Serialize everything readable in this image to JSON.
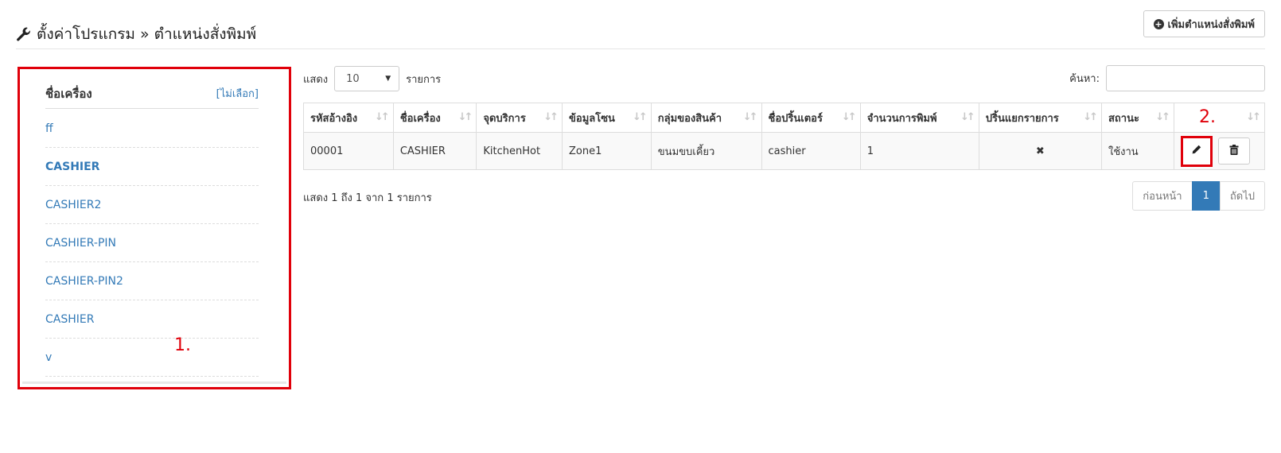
{
  "header": {
    "title": "ตั้งค่าโปรแกรม » ตำแหน่งสั่งพิมพ์",
    "add_button_label": "เพิ่มตำแหน่งสั่งพิมพ์"
  },
  "left_panel": {
    "heading": "ชื่อเครื่อง",
    "none_link": "[ไม่เลือก]",
    "devices": [
      "ff",
      "CASHIER",
      "CASHIER2",
      "CASHIER-PIN",
      "CASHIER-PIN2",
      "CASHIER",
      "v"
    ],
    "annotation": "1."
  },
  "table_controls": {
    "show_label": "แสดง",
    "page_length": "10",
    "entries_label": "รายการ",
    "search_label": "ค้นหา:"
  },
  "table": {
    "columns": [
      "รหัสอ้างอิง",
      "ชื่อเครื่อง",
      "จุดบริการ",
      "ข้อมูลโซน",
      "กลุ่มของสินค้า",
      "ชื่อปริ้นเตอร์",
      "จำนวนการพิมพ์",
      "ปริ้นแยกรายการ",
      "สถานะ",
      ""
    ],
    "rows": [
      [
        "00001",
        "CASHIER",
        "KitchenHot",
        "Zone1",
        "ขนมขบเคี้ยว",
        "cashier",
        "1",
        "✖",
        "ใช้งาน"
      ]
    ],
    "annotation": "2."
  },
  "footer": {
    "info": "แสดง 1 ถึง 1 จาก 1 รายการ",
    "prev": "ก่อนหน้า",
    "current_page": "1",
    "next": "ถัดไป"
  },
  "icons": {
    "header": "wrench-icon",
    "add": "plus-circle-icon",
    "edit": "pencil-icon",
    "delete": "trash-icon",
    "sort": "sort-icon"
  },
  "colors": {
    "accent": "#337ab7",
    "annotation": "#e0000a"
  }
}
